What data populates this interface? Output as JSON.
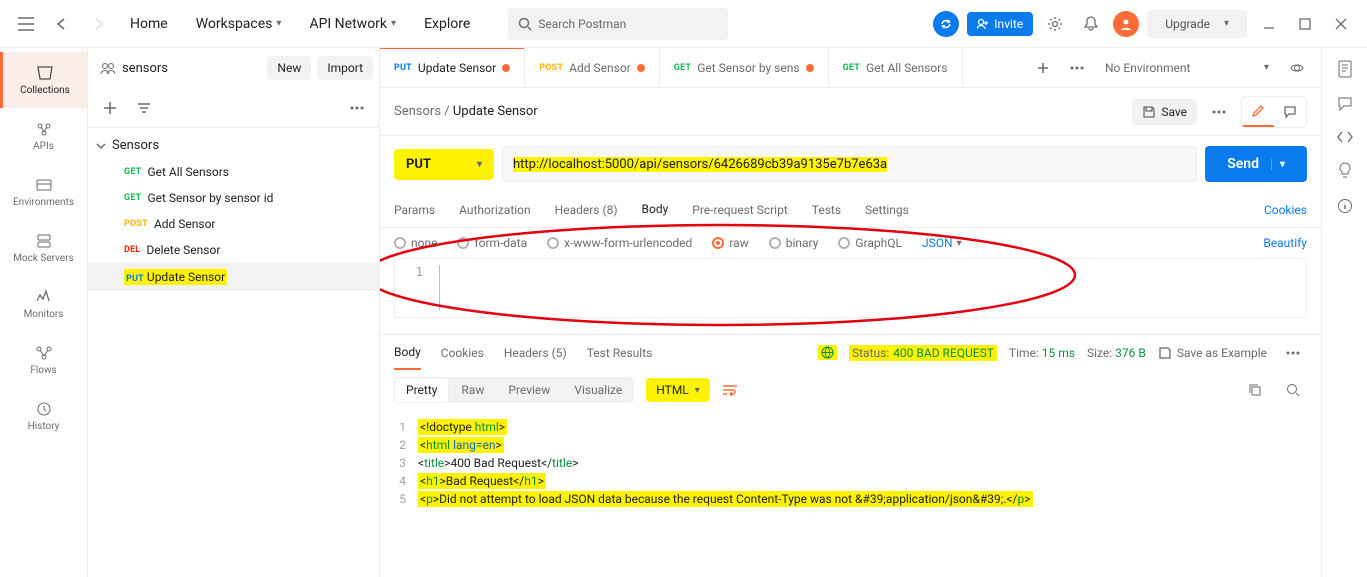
{
  "topbar": {
    "home": "Home",
    "workspaces": "Workspaces",
    "api_network": "API Network",
    "explore": "Explore",
    "search_placeholder": "Search Postman",
    "invite": "Invite",
    "upgrade": "Upgrade"
  },
  "workspace": {
    "name": "sensors",
    "new": "New",
    "import": "Import"
  },
  "leftNav": {
    "collections": "Collections",
    "apis": "APIs",
    "environments": "Environments",
    "mock_servers": "Mock Servers",
    "monitors": "Monitors",
    "flows": "Flows",
    "history": "History"
  },
  "tree": {
    "folder": "Sensors",
    "items": [
      {
        "method": "GET",
        "label": "Get All Sensors"
      },
      {
        "method": "GET",
        "label": "Get Sensor by sensor id"
      },
      {
        "method": "POST",
        "label": "Add Sensor"
      },
      {
        "method": "DEL",
        "label": "Delete Sensor"
      },
      {
        "method": "PUT",
        "label": "Update Sensor"
      }
    ]
  },
  "tabs": [
    {
      "method": "PUT",
      "label": "Update Sensor",
      "modified": true,
      "active": true
    },
    {
      "method": "POST",
      "label": "Add Sensor",
      "modified": true
    },
    {
      "method": "GET",
      "label": "Get Sensor by sens",
      "modified": true
    },
    {
      "method": "GET",
      "label": "Get All Sensors",
      "modified": false
    }
  ],
  "env": "No Environment",
  "breadcrumb": {
    "root": "Sensors",
    "current": "Update Sensor",
    "save": "Save"
  },
  "request": {
    "method": "PUT",
    "url": "http://localhost:5000/api/sensors/6426689cb39a9135e7b7e63a",
    "send": "Send",
    "tabs": {
      "params": "Params",
      "authorization": "Authorization",
      "headers": "Headers (8)",
      "body": "Body",
      "prerequest": "Pre-request Script",
      "tests": "Tests",
      "settings": "Settings",
      "cookies": "Cookies"
    },
    "body_types": {
      "none": "none",
      "formdata": "form-data",
      "urlencoded": "x-www-form-urlencoded",
      "raw": "raw",
      "binary": "binary",
      "graphql": "GraphQL"
    },
    "raw_lang": "JSON",
    "beautify": "Beautify",
    "editor_line": "1"
  },
  "response": {
    "tabs": {
      "body": "Body",
      "cookies": "Cookies",
      "headers": "Headers (5)",
      "test_results": "Test Results"
    },
    "status_label": "Status:",
    "status": "400 BAD REQUEST",
    "time_label": "Time:",
    "time": "15 ms",
    "size_label": "Size:",
    "size": "376 B",
    "save_example": "Save as Example",
    "view": {
      "pretty": "Pretty",
      "raw": "Raw",
      "preview": "Preview",
      "visualize": "Visualize"
    },
    "lang": "HTML",
    "lines": [
      "<!doctype html>",
      "<html lang=en>",
      "<title>400 Bad Request</title>",
      "<h1>Bad Request</h1>",
      "<p>Did not attempt to load JSON data because the request Content-Type was not &#39;application/json&#39;.</p>"
    ]
  }
}
